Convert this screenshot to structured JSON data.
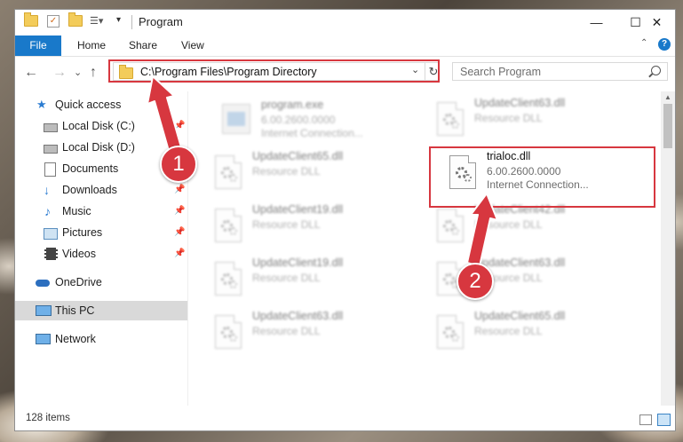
{
  "window": {
    "title": "Program",
    "minimize_glyph": "—",
    "maximize_glyph": "☐",
    "close_glyph": "✕"
  },
  "ribbon": {
    "tabs": [
      "File",
      "Home",
      "Share",
      "View"
    ]
  },
  "address_bar": {
    "path": "C:\\Program Files\\Program Directory",
    "search_placeholder": "Search Program"
  },
  "nav_glyphs": {
    "back": "←",
    "forward": "→",
    "recent": "⌄",
    "up": "↑",
    "refresh": "↻",
    "dropdown": "⌄"
  },
  "sidebar": {
    "items": [
      {
        "label": "Quick access",
        "icon": "star-icon",
        "pinned": false
      },
      {
        "label": "Local Disk (C:)",
        "icon": "drive-icon",
        "pinned": true
      },
      {
        "label": "Local Disk (D:)",
        "icon": "drive-icon",
        "pinned": false
      },
      {
        "label": "Documents",
        "icon": "documents-icon",
        "pinned": true
      },
      {
        "label": "Downloads",
        "icon": "download-icon",
        "pinned": true
      },
      {
        "label": "Music",
        "icon": "music-icon",
        "pinned": true
      },
      {
        "label": "Pictures",
        "icon": "pictures-icon",
        "pinned": true
      },
      {
        "label": "Videos",
        "icon": "videos-icon",
        "pinned": true
      },
      {
        "label": "OneDrive",
        "icon": "cloud-icon",
        "pinned": false
      },
      {
        "label": "This PC",
        "icon": "computer-icon",
        "pinned": false,
        "selected": true
      },
      {
        "label": "Network",
        "icon": "network-icon",
        "pinned": false
      }
    ]
  },
  "files": [
    {
      "name": "program.exe",
      "line2": "6.00.2600.0000",
      "line3": "Internet Connection...",
      "blurred": true
    },
    {
      "name": "UpdateClient63.dll",
      "line2": "Resource DLL",
      "line3": "",
      "blurred": true
    },
    {
      "name": "UpdateClient65.dll",
      "line2": "Resource DLL",
      "line3": "",
      "blurred": true
    },
    {
      "name": "trialoc.dll",
      "line2": "6.00.2600.0000",
      "line3": "Internet Connection...",
      "blurred": false
    },
    {
      "name": "UpdateClient19.dll",
      "line2": "Resource DLL",
      "line3": "",
      "blurred": true
    },
    {
      "name": "UpdateClient42.dll",
      "line2": "Resource DLL",
      "line3": "",
      "blurred": true
    },
    {
      "name": "UpdateClient19.dll",
      "line2": "Resource DLL",
      "line3": "",
      "blurred": true
    },
    {
      "name": "UpdateClient63.dll",
      "line2": "Resource DLL",
      "line3": "",
      "blurred": true
    },
    {
      "name": "UpdateClient63.dll",
      "line2": "Resource DLL",
      "line3": "",
      "blurred": true
    },
    {
      "name": "UpdateClient65.dll",
      "line2": "Resource DLL",
      "line3": "",
      "blurred": true
    }
  ],
  "status": {
    "item_count": "128 items"
  },
  "annotations": {
    "step1": "1",
    "step2": "2",
    "color": "#d7373f"
  }
}
